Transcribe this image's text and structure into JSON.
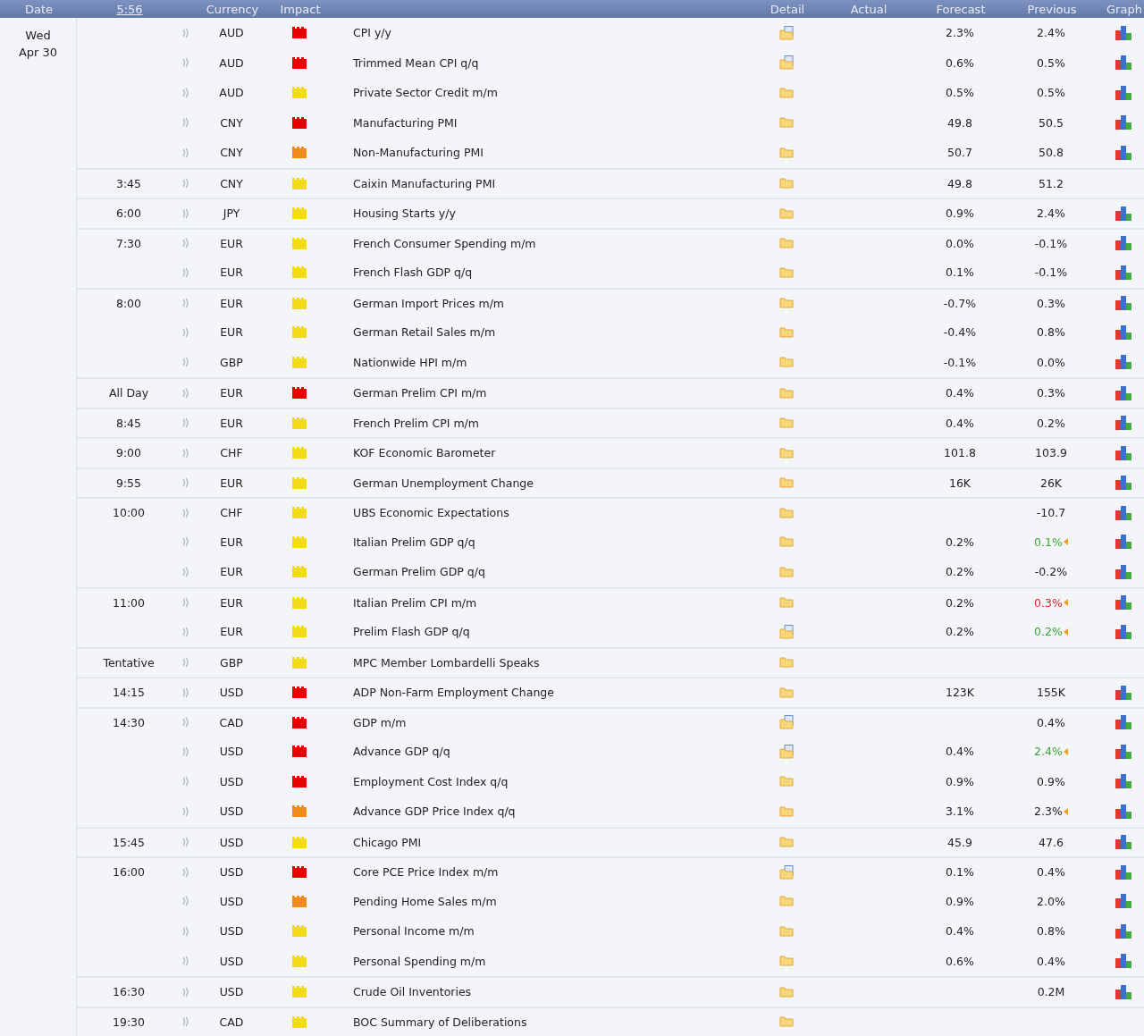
{
  "header": {
    "date": "Date",
    "clock": "5:56",
    "currency": "Currency",
    "impact": "Impact",
    "detail": "Detail",
    "actual": "Actual",
    "forecast": "Forecast",
    "previous": "Previous",
    "graph": "Graph"
  },
  "day": {
    "weekday": "Wed",
    "date": "Apr 30"
  },
  "rows": [
    {
      "time": "",
      "currency": "AUD",
      "impact": {
        "color": "#e80000"
      },
      "event": "CPI y/y",
      "has_note": true,
      "forecast": "2.3%",
      "previous": {
        "value": "2.4%",
        "revised": false
      },
      "graph": true
    },
    {
      "time": "",
      "currency": "AUD",
      "impact": {
        "color": "#e80000"
      },
      "event": "Trimmed Mean CPI q/q",
      "has_note": true,
      "forecast": "0.6%",
      "previous": {
        "value": "0.5%",
        "revised": false
      },
      "graph": true
    },
    {
      "time": "",
      "currency": "AUD",
      "impact": {
        "color": "#f2dc1a"
      },
      "event": "Private Sector Credit m/m",
      "has_note": false,
      "forecast": "0.5%",
      "previous": {
        "value": "0.5%",
        "revised": false
      },
      "graph": true
    },
    {
      "time": "",
      "currency": "CNY",
      "impact": {
        "color": "#e80000"
      },
      "event": "Manufacturing PMI",
      "has_note": false,
      "forecast": "49.8",
      "previous": {
        "value": "50.5",
        "revised": false
      },
      "graph": true
    },
    {
      "time": "",
      "currency": "CNY",
      "impact": {
        "color": "#f08a1c"
      },
      "event": "Non-Manufacturing PMI",
      "has_note": false,
      "forecast": "50.7",
      "previous": {
        "value": "50.8",
        "revised": false
      },
      "graph": true
    },
    {
      "time": "3:45",
      "currency": "CNY",
      "impact": {
        "color": "#f2dc1a"
      },
      "event": "Caixin Manufacturing PMI",
      "has_note": false,
      "forecast": "49.8",
      "previous": {
        "value": "51.2",
        "revised": false
      },
      "graph": false
    },
    {
      "time": "6:00",
      "currency": "JPY",
      "impact": {
        "color": "#f2dc1a"
      },
      "event": "Housing Starts y/y",
      "has_note": false,
      "forecast": "0.9%",
      "previous": {
        "value": "2.4%",
        "revised": false
      },
      "graph": true
    },
    {
      "time": "7:30",
      "currency": "EUR",
      "impact": {
        "color": "#f2dc1a"
      },
      "event": "French Consumer Spending m/m",
      "has_note": false,
      "forecast": "0.0%",
      "previous": {
        "value": "-0.1%",
        "revised": false
      },
      "graph": true
    },
    {
      "time": "",
      "currency": "EUR",
      "impact": {
        "color": "#f2dc1a"
      },
      "event": "French Flash GDP q/q",
      "has_note": false,
      "forecast": "0.1%",
      "previous": {
        "value": "-0.1%",
        "revised": false
      },
      "graph": true
    },
    {
      "time": "8:00",
      "currency": "EUR",
      "impact": {
        "color": "#f2dc1a"
      },
      "event": "German Import Prices m/m",
      "has_note": false,
      "forecast": "-0.7%",
      "previous": {
        "value": "0.3%",
        "revised": false
      },
      "graph": true
    },
    {
      "time": "",
      "currency": "EUR",
      "impact": {
        "color": "#f2dc1a"
      },
      "event": "German Retail Sales m/m",
      "has_note": false,
      "forecast": "-0.4%",
      "previous": {
        "value": "0.8%",
        "revised": false
      },
      "graph": true
    },
    {
      "time": "",
      "currency": "GBP",
      "impact": {
        "color": "#f2dc1a"
      },
      "event": "Nationwide HPI m/m",
      "has_note": false,
      "forecast": "-0.1%",
      "previous": {
        "value": "0.0%",
        "revised": false
      },
      "graph": true
    },
    {
      "time": "All Day",
      "currency": "EUR",
      "impact": {
        "color": "#e80000"
      },
      "event": "German Prelim CPI m/m",
      "has_note": false,
      "forecast": "0.4%",
      "previous": {
        "value": "0.3%",
        "revised": false
      },
      "graph": true
    },
    {
      "time": "8:45",
      "currency": "EUR",
      "impact": {
        "color": "#f2dc1a"
      },
      "event": "French Prelim CPI m/m",
      "has_note": false,
      "forecast": "0.4%",
      "previous": {
        "value": "0.2%",
        "revised": false
      },
      "graph": true
    },
    {
      "time": "9:00",
      "currency": "CHF",
      "impact": {
        "color": "#f2dc1a"
      },
      "event": "KOF Economic Barometer",
      "has_note": false,
      "forecast": "101.8",
      "previous": {
        "value": "103.9",
        "revised": false
      },
      "graph": true
    },
    {
      "time": "9:55",
      "currency": "EUR",
      "impact": {
        "color": "#f2dc1a"
      },
      "event": "German Unemployment Change",
      "has_note": false,
      "forecast": "16K",
      "previous": {
        "value": "26K",
        "revised": false
      },
      "graph": true
    },
    {
      "time": "10:00",
      "currency": "CHF",
      "impact": {
        "color": "#f2dc1a"
      },
      "event": "UBS Economic Expectations",
      "has_note": false,
      "previous": {
        "value": "-10.7",
        "revised": false
      },
      "graph": true
    },
    {
      "time": "",
      "currency": "EUR",
      "impact": {
        "color": "#f2dc1a"
      },
      "event": "Italian Prelim GDP q/q",
      "has_note": false,
      "forecast": "0.2%",
      "previous": {
        "value": "0.1%",
        "revised": true,
        "color": "#3aa835"
      },
      "graph": true
    },
    {
      "time": "",
      "currency": "EUR",
      "impact": {
        "color": "#f2dc1a"
      },
      "event": "German Prelim GDP q/q",
      "has_note": false,
      "forecast": "0.2%",
      "previous": {
        "value": "-0.2%",
        "revised": false
      },
      "graph": true
    },
    {
      "time": "11:00",
      "currency": "EUR",
      "impact": {
        "color": "#f2dc1a"
      },
      "event": "Italian Prelim CPI m/m",
      "has_note": false,
      "forecast": "0.2%",
      "previous": {
        "value": "0.3%",
        "revised": true,
        "color": "#d8262e"
      },
      "graph": true
    },
    {
      "time": "",
      "currency": "EUR",
      "impact": {
        "color": "#f2dc1a"
      },
      "event": "Prelim Flash GDP q/q",
      "has_note": true,
      "forecast": "0.2%",
      "previous": {
        "value": "0.2%",
        "revised": true,
        "color": "#3aa835"
      },
      "graph": true
    },
    {
      "time": "Tentative",
      "currency": "GBP",
      "impact": {
        "color": "#f2dc1a"
      },
      "event": "MPC Member Lombardelli Speaks",
      "has_note": false,
      "graph": false
    },
    {
      "time": "14:15",
      "currency": "USD",
      "impact": {
        "color": "#e80000"
      },
      "event": "ADP Non-Farm Employment Change",
      "has_note": false,
      "forecast": "123K",
      "previous": {
        "value": "155K",
        "revised": false
      },
      "graph": true
    },
    {
      "time": "14:30",
      "currency": "CAD",
      "impact": {
        "color": "#e80000"
      },
      "event": "GDP m/m",
      "has_note": true,
      "previous": {
        "value": "0.4%",
        "revised": false
      },
      "graph": true
    },
    {
      "time": "",
      "currency": "USD",
      "impact": {
        "color": "#e80000"
      },
      "event": "Advance GDP q/q",
      "has_note": true,
      "forecast": "0.4%",
      "previous": {
        "value": "2.4%",
        "revised": true,
        "color": "#3aa835"
      },
      "graph": true
    },
    {
      "time": "",
      "currency": "USD",
      "impact": {
        "color": "#e80000"
      },
      "event": "Employment Cost Index q/q",
      "has_note": false,
      "forecast": "0.9%",
      "previous": {
        "value": "0.9%",
        "revised": false
      },
      "graph": true
    },
    {
      "time": "",
      "currency": "USD",
      "impact": {
        "color": "#f08a1c"
      },
      "event": "Advance GDP Price Index q/q",
      "has_note": false,
      "forecast": "3.1%",
      "previous": {
        "value": "2.3%",
        "revised": true
      },
      "graph": true
    },
    {
      "time": "15:45",
      "currency": "USD",
      "impact": {
        "color": "#f2dc1a"
      },
      "event": "Chicago PMI",
      "has_note": false,
      "forecast": "45.9",
      "previous": {
        "value": "47.6",
        "revised": false
      },
      "graph": true
    },
    {
      "time": "16:00",
      "currency": "USD",
      "impact": {
        "color": "#e80000"
      },
      "event": "Core PCE Price Index m/m",
      "has_note": true,
      "forecast": "0.1%",
      "previous": {
        "value": "0.4%",
        "revised": false
      },
      "graph": true
    },
    {
      "time": "",
      "currency": "USD",
      "impact": {
        "color": "#f08a1c"
      },
      "event": "Pending Home Sales m/m",
      "has_note": false,
      "forecast": "0.9%",
      "previous": {
        "value": "2.0%",
        "revised": false
      },
      "graph": true
    },
    {
      "time": "",
      "currency": "USD",
      "impact": {
        "color": "#f2dc1a"
      },
      "event": "Personal Income m/m",
      "has_note": false,
      "forecast": "0.4%",
      "previous": {
        "value": "0.8%",
        "revised": false
      },
      "graph": true
    },
    {
      "time": "",
      "currency": "USD",
      "impact": {
        "color": "#f2dc1a"
      },
      "event": "Personal Spending m/m",
      "has_note": false,
      "forecast": "0.6%",
      "previous": {
        "value": "0.4%",
        "revised": false
      },
      "graph": true
    },
    {
      "time": "16:30",
      "currency": "USD",
      "impact": {
        "color": "#f2dc1a"
      },
      "event": "Crude Oil Inventories",
      "has_note": false,
      "previous": {
        "value": "0.2M",
        "revised": false
      },
      "graph": true
    },
    {
      "time": "19:30",
      "currency": "CAD",
      "impact": {
        "color": "#f2dc1a"
      },
      "event": "BOC Summary of Deliberations",
      "has_note": false,
      "graph": false
    }
  ]
}
